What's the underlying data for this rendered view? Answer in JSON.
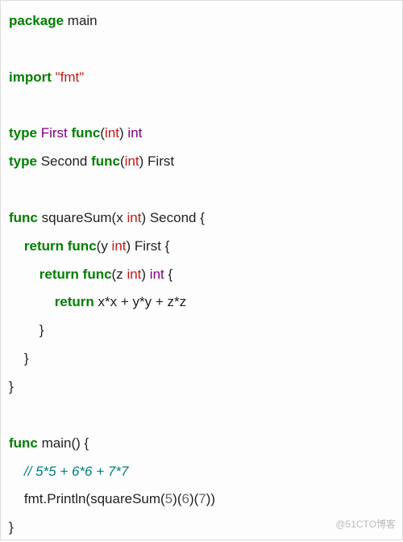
{
  "code": {
    "l01": {
      "kw_package": "package",
      "name": "main"
    },
    "l03": {
      "kw_import": "import",
      "pkg": "\"fmt\""
    },
    "l05": {
      "kw_type": "type",
      "name": "First",
      "kw_func": "func",
      "lp": "(",
      "param_t": "int",
      "rp": ")",
      "sp": " ",
      "ret_t": "int"
    },
    "l06": {
      "kw_type": "type",
      "name": "Second",
      "kw_func": "func",
      "lp": "(",
      "param_t": "int",
      "rp": ")",
      "sp": " ",
      "ret_t": "First"
    },
    "l08": {
      "kw_func": "func",
      "name": "squareSum(x",
      "sp": " ",
      "param_t": "int",
      "sig_rest": ") Second {"
    },
    "l09": {
      "indent": "    ",
      "kw_return": "return",
      "sp": " ",
      "kw_func": "func",
      "sig_l": "(y ",
      "param_t": "int",
      "sig_r": ") First {"
    },
    "l10": {
      "indent": "        ",
      "kw_return": "return",
      "sp": " ",
      "kw_func": "func",
      "sig_l": "(z ",
      "param_t": "int",
      "sig_m": ") ",
      "ret_t": "int",
      "brace": " {"
    },
    "l11": {
      "indent": "            ",
      "kw_return": "return",
      "expr": " x*x + y*y + z*z"
    },
    "l12": {
      "indent": "        ",
      "brace": "}"
    },
    "l13": {
      "indent": "    ",
      "brace": "}"
    },
    "l14": {
      "brace": "}"
    },
    "l16": {
      "kw_func": "func",
      "name": "main() {"
    },
    "l17": {
      "indent": "    ",
      "comment": "// 5*5 + 6*6 + 7*7"
    },
    "l18": {
      "indent": "    ",
      "call_l": "fmt.Println(squareSum(",
      "n1": "5",
      "m1": ")(",
      "n2": "6",
      "m2": ")(",
      "n3": "7",
      "call_r": "))"
    },
    "l19": {
      "brace": "}"
    }
  },
  "watermark": "@51CTO博客"
}
